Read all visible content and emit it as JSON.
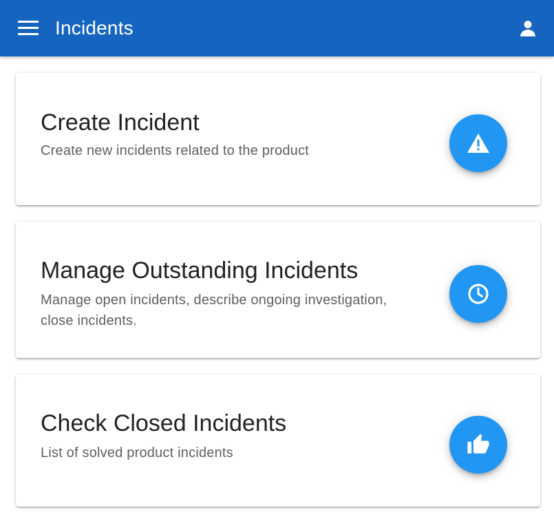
{
  "app_bar": {
    "title": "Incidents",
    "background": "#1565c0",
    "menu_icon": "menu-icon",
    "account_icon": "account-icon"
  },
  "cards": [
    {
      "title": "Create Incident",
      "description": "Create new incidents related to the product",
      "icon": "warning-icon"
    },
    {
      "title": "Manage Outstanding Incidents",
      "description": "Manage open incidents, describe ongoing investigation, close incidents.",
      "icon": "clock-icon"
    },
    {
      "title": "Check Closed Incidents",
      "description": "List of solved product incidents",
      "icon": "thumb-up-icon"
    }
  ],
  "colors": {
    "accent": "#2196f3",
    "title_text": "#212121",
    "description_text": "#5f5f5f"
  }
}
